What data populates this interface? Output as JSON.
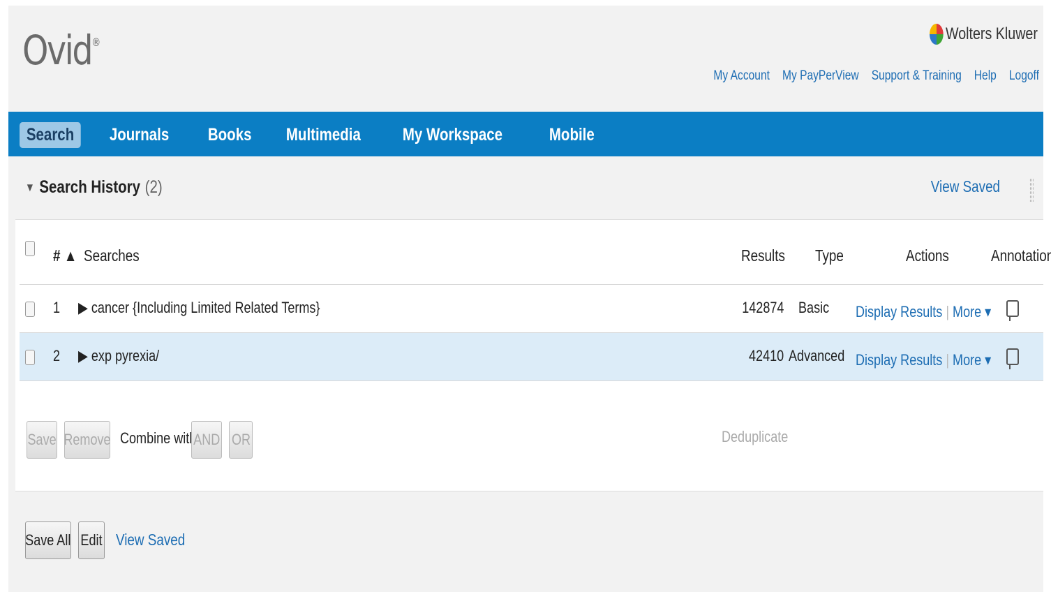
{
  "brand": {
    "logo_text": "Ovid",
    "logo_mark": "®",
    "publisher": "Wolters Kluwer"
  },
  "top_links": [
    "My Account",
    "My PayPerView",
    "Support & Training",
    "Help",
    "Logoff"
  ],
  "nav": [
    "Search",
    "Journals",
    "Books",
    "Multimedia",
    "My Workspace",
    "Mobile"
  ],
  "history": {
    "title": "Search History",
    "count": "(2)",
    "view_saved": "View Saved",
    "columns": {
      "num": "#",
      "sort_arrow": "▲",
      "searches": "Searches",
      "results": "Results",
      "type": "Type",
      "actions": "Actions",
      "annotations": "Annotations"
    },
    "rows": [
      {
        "num": "1",
        "search": "cancer {Including Limited Related Terms}",
        "results": "142874",
        "type": "Basic",
        "display": "Display Results",
        "more": "More ▾"
      },
      {
        "num": "2",
        "search": "exp pyrexia/",
        "results": "42410",
        "type": "Advanced",
        "display": "Display Results",
        "more": "More ▾"
      }
    ],
    "buttons": {
      "save": "Save",
      "remove": "Remove",
      "combine_label": "Combine with:",
      "and": "AND",
      "or": "OR",
      "deduplicate": "Deduplicate"
    }
  },
  "footer": {
    "save_all": "Save All",
    "edit": "Edit",
    "view_saved": "View Saved"
  },
  "colors": {
    "nav_bg": "#0b7ec4",
    "link": "#1d6db3",
    "row_selected": "#dcecf8"
  }
}
